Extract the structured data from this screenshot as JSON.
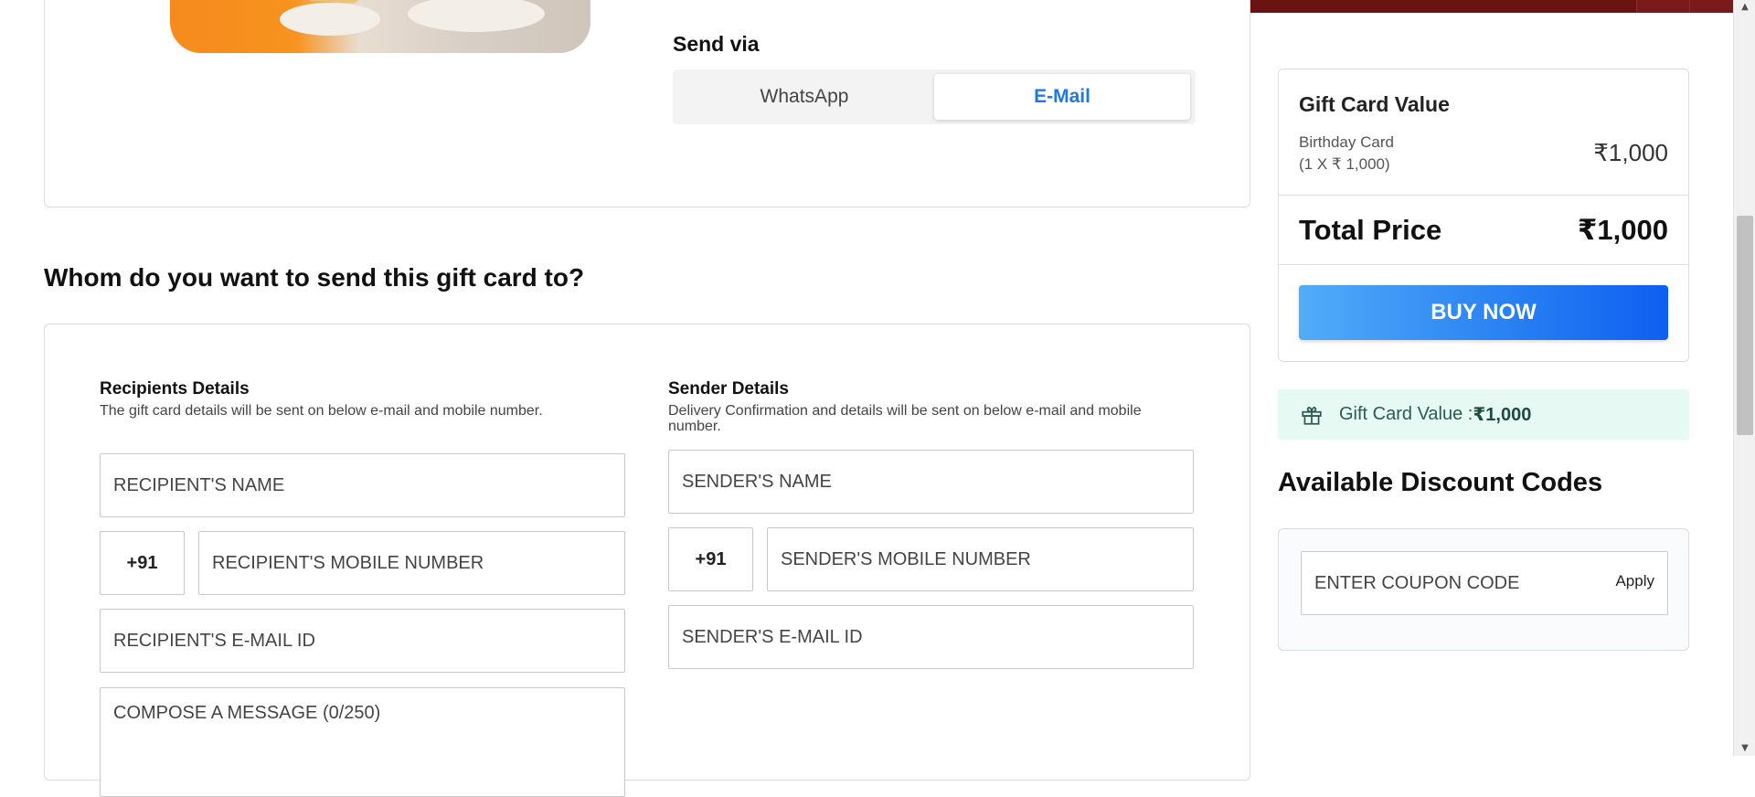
{
  "send_via": {
    "title": "Send via",
    "options": [
      "WhatsApp",
      "E-Mail"
    ],
    "selected": "E-Mail"
  },
  "section_heading": "Whom do you want to send this gift card to?",
  "recipient": {
    "title": "Recipients Details",
    "subtitle": "The gift card details will be sent on below e-mail and mobile number.",
    "name_placeholder": "RECIPIENT'S NAME",
    "country_code": "+91",
    "mobile_placeholder": "RECIPIENT'S MOBILE NUMBER",
    "email_placeholder": "RECIPIENT'S E-MAIL ID",
    "message_placeholder": "COMPOSE A MESSAGE (0/250)"
  },
  "sender": {
    "title": "Sender Details",
    "subtitle_line1": "Delivery Confirmation and details will be sent on below e-mail and mobile",
    "subtitle_line2": "number.",
    "name_placeholder": "SENDER'S NAME",
    "country_code": "+91",
    "mobile_placeholder": "SENDER'S MOBILE NUMBER",
    "email_placeholder": "SENDER'S E-MAIL ID"
  },
  "summary": {
    "title": "Gift Card Value",
    "item_name": "Birthday Card",
    "item_calc": "(1 X ₹ 1,000)",
    "item_price": "₹1,000",
    "total_label": "Total Price",
    "total_value": "₹1,000",
    "buy_label": "BUY NOW"
  },
  "gift_banner": {
    "label": "Gift Card Value : ",
    "value": "₹1,000"
  },
  "discount": {
    "heading": "Available Discount Codes",
    "coupon_placeholder": "ENTER COUPON CODE",
    "apply_label": "Apply"
  },
  "colors": {
    "accent_blue": "#1b7ae8",
    "buy_gradient_start": "#52acf8",
    "buy_gradient_end": "#0e5ff0",
    "banner_bg": "#e6faf3",
    "header_red": "#6b1212"
  },
  "icons": {
    "gift": "gift-icon",
    "scroll_up": "scroll-up-arrow-icon",
    "scroll_down": "scroll-down-arrow-icon"
  }
}
